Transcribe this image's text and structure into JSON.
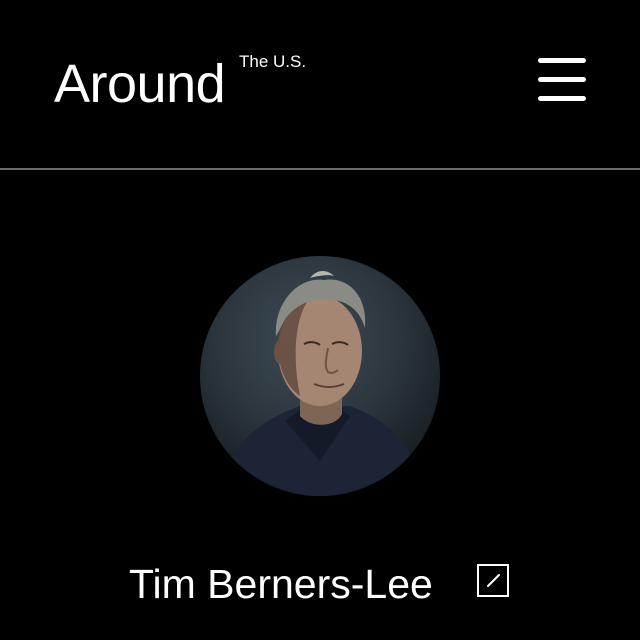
{
  "header": {
    "brand_name": "Around",
    "brand_sub": "The U.S.",
    "menu_icon": "hamburger-menu-icon"
  },
  "profile": {
    "name": "Tim Berners-Lee",
    "avatar": "profile-photo",
    "edit_icon": "pencil-icon"
  },
  "colors": {
    "background": "#000000",
    "text": "#ffffff",
    "divider": "#6b6b6b"
  }
}
